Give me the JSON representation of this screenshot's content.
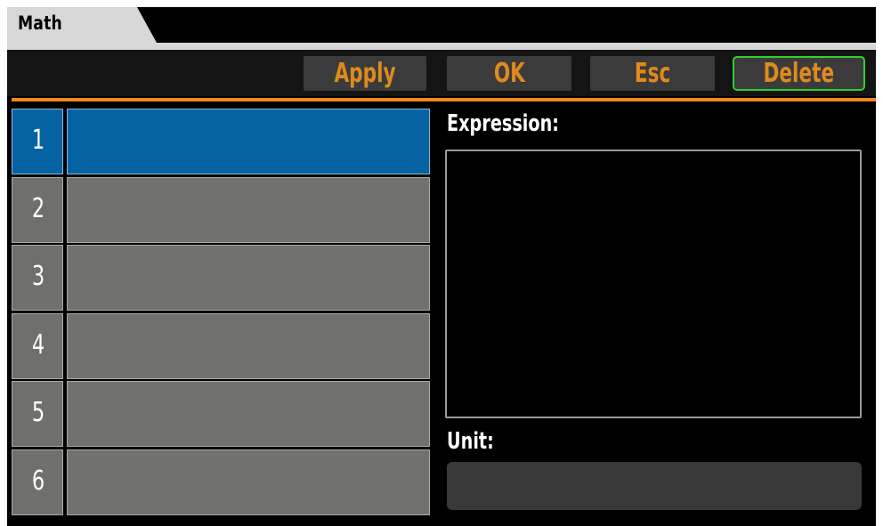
{
  "tab": {
    "label": "Math"
  },
  "toolbar": {
    "apply_label": "Apply",
    "ok_label": "OK",
    "esc_label": "Esc",
    "delete_label": "Delete"
  },
  "list": {
    "rows": [
      {
        "number": "1",
        "value": "",
        "selected": true
      },
      {
        "number": "2",
        "value": ""
      },
      {
        "number": "3",
        "value": ""
      },
      {
        "number": "4",
        "value": ""
      },
      {
        "number": "5",
        "value": ""
      },
      {
        "number": "6",
        "value": ""
      }
    ]
  },
  "expression": {
    "label": "Expression:",
    "value": ""
  },
  "unit": {
    "label": "Unit:",
    "value": ""
  },
  "colors": {
    "accent_orange": "#f08a1d",
    "button_text": "#e08a1e",
    "delete_border": "#2fd12f",
    "selected_row": "#0563a3",
    "row_gray": "#71726d"
  }
}
